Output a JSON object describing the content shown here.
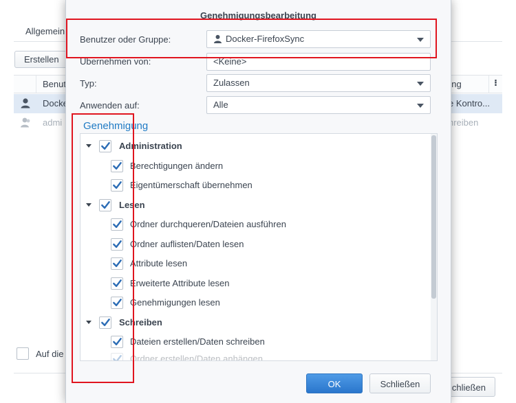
{
  "background_window": {
    "tab_general": "Allgemein",
    "create_button": "Erstellen",
    "column_user": "Benut",
    "column_right": "ung",
    "column_more": "⁝",
    "rows": [
      {
        "col1": "Docke",
        "col2": "e Kontro..."
      },
      {
        "col1": "admi",
        "col2": "hreiben"
      }
    ],
    "apply_label": "Auf die",
    "close_button": "chließen"
  },
  "dialog": {
    "title": "Genehmigungsbearbeitung",
    "fields": {
      "user_group_label": "Benutzer oder Gruppe:",
      "user_group_value": "Docker-FirefoxSync",
      "inherit_label": "Übernehmen von:",
      "inherit_value": "<Keine>",
      "type_label": "Typ:",
      "type_value": "Zulassen",
      "apply_label": "Anwenden auf:",
      "apply_value": "Alle"
    },
    "section_title": "Genehmigung",
    "permissions": [
      {
        "label": "Administration",
        "group": true,
        "checked": true
      },
      {
        "label": "Berechtigungen ändern",
        "group": false,
        "checked": true
      },
      {
        "label": "Eigentümerschaft übernehmen",
        "group": false,
        "checked": true
      },
      {
        "label": "Lesen",
        "group": true,
        "checked": true
      },
      {
        "label": "Ordner durchqueren/Dateien ausführen",
        "group": false,
        "checked": true
      },
      {
        "label": "Ordner auflisten/Daten lesen",
        "group": false,
        "checked": true
      },
      {
        "label": "Attribute lesen",
        "group": false,
        "checked": true
      },
      {
        "label": "Erweiterte Attribute lesen",
        "group": false,
        "checked": true
      },
      {
        "label": "Genehmigungen lesen",
        "group": false,
        "checked": true
      },
      {
        "label": "Schreiben",
        "group": true,
        "checked": true
      },
      {
        "label": "Dateien erstellen/Daten schreiben",
        "group": false,
        "checked": true
      },
      {
        "label": "Ordner erstellen/Daten anhängen",
        "group": false,
        "checked": true
      }
    ],
    "ok_button": "OK",
    "close_button": "Schließen"
  },
  "colors": {
    "accent_blue": "#1f7ac4",
    "ok_button": "#2a76cc",
    "annotation_red": "#e0141e",
    "selected_row": "#dfe9f5"
  }
}
